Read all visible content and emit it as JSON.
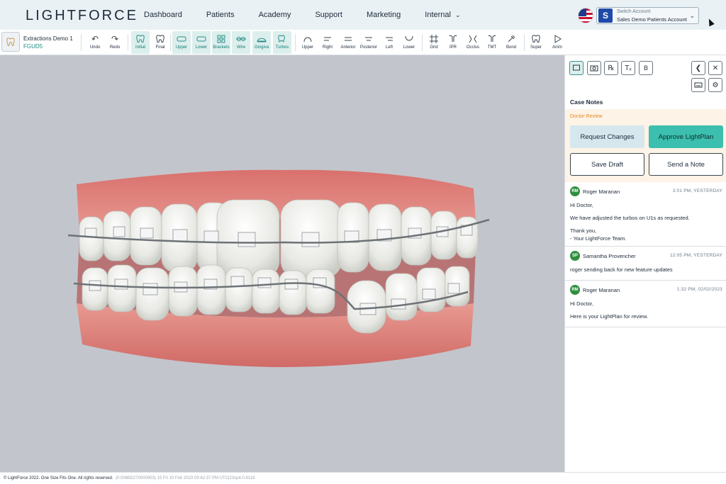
{
  "brand": {
    "logo_light": "LIGHT",
    "logo_force": "FORCE"
  },
  "nav": {
    "items": [
      "Dashboard",
      "Patients",
      "Academy",
      "Support",
      "Marketing",
      "Internal"
    ]
  },
  "account": {
    "initial": "S",
    "switch_label": "Switch Account",
    "name": "Sales Demo Patients Account"
  },
  "case": {
    "title": "Extractions Demo 1",
    "code": "FGUD5"
  },
  "toolbar": {
    "undo": "Undo",
    "redo": "Redo",
    "initial": "Initial",
    "final": "Final",
    "upper": "Upper",
    "lower": "Lower",
    "brackets": "Brackets",
    "wire": "Wire",
    "gingiva": "Gingiva",
    "turbos": "Turbos",
    "view_upper": "Upper",
    "right": "Right",
    "anterior": "Anterior",
    "posterior": "Posterior",
    "left": "Left",
    "view_lower": "Lower",
    "grid": "Grid",
    "ipr": "IPR",
    "occlus": "Occlus",
    "tmt": "TMT",
    "bond": "Bond",
    "super": "Super",
    "anim": "Anim"
  },
  "panel": {
    "case_notes": "Case Notes",
    "review_label": "Doctor Review",
    "request_changes": "Request Changes",
    "approve": "Approve LightPlan",
    "save_draft": "Save Draft",
    "send_note": "Send a Note",
    "bold_label": "B",
    "notes": [
      {
        "initials": "RM",
        "author": "Roger Maranan",
        "time": "3:01 PM, YESTERDAY",
        "lines": [
          "Hi Doctor,",
          "",
          "We have adjusted the turbos on U1s as requested.",
          "",
          "Thank you,",
          "- Your LightForce Team."
        ]
      },
      {
        "initials": "SP",
        "author": "Samantha Provencher",
        "time": "12:05 PM, YESTERDAY",
        "lines": [
          "roger sending back for new feature updates"
        ]
      },
      {
        "initials": "RM",
        "author": "Roger Maranan",
        "time": "1:32 PM, 02/02/2023",
        "lines": [
          "Hi Doctor,",
          "",
          "Here is your LightPlan for review."
        ]
      }
    ]
  },
  "footer": {
    "copyright": "© LightForce 2022. One Size Fits One. All rights reserved.",
    "version": "(0.0086D270000953) 15 Fri 10 Feb 2023 03:42:37 PM UTC|23sp4.0.8118"
  },
  "colors": {
    "accent": "#3cbfae",
    "nav_bg": "#eaf1f5",
    "viewer_bg": "#c3c5cc",
    "review_bg": "#fdf3e6",
    "review_label": "#e58a23",
    "gum": "#e07d78",
    "avatar_green": "#2e8f3e"
  }
}
